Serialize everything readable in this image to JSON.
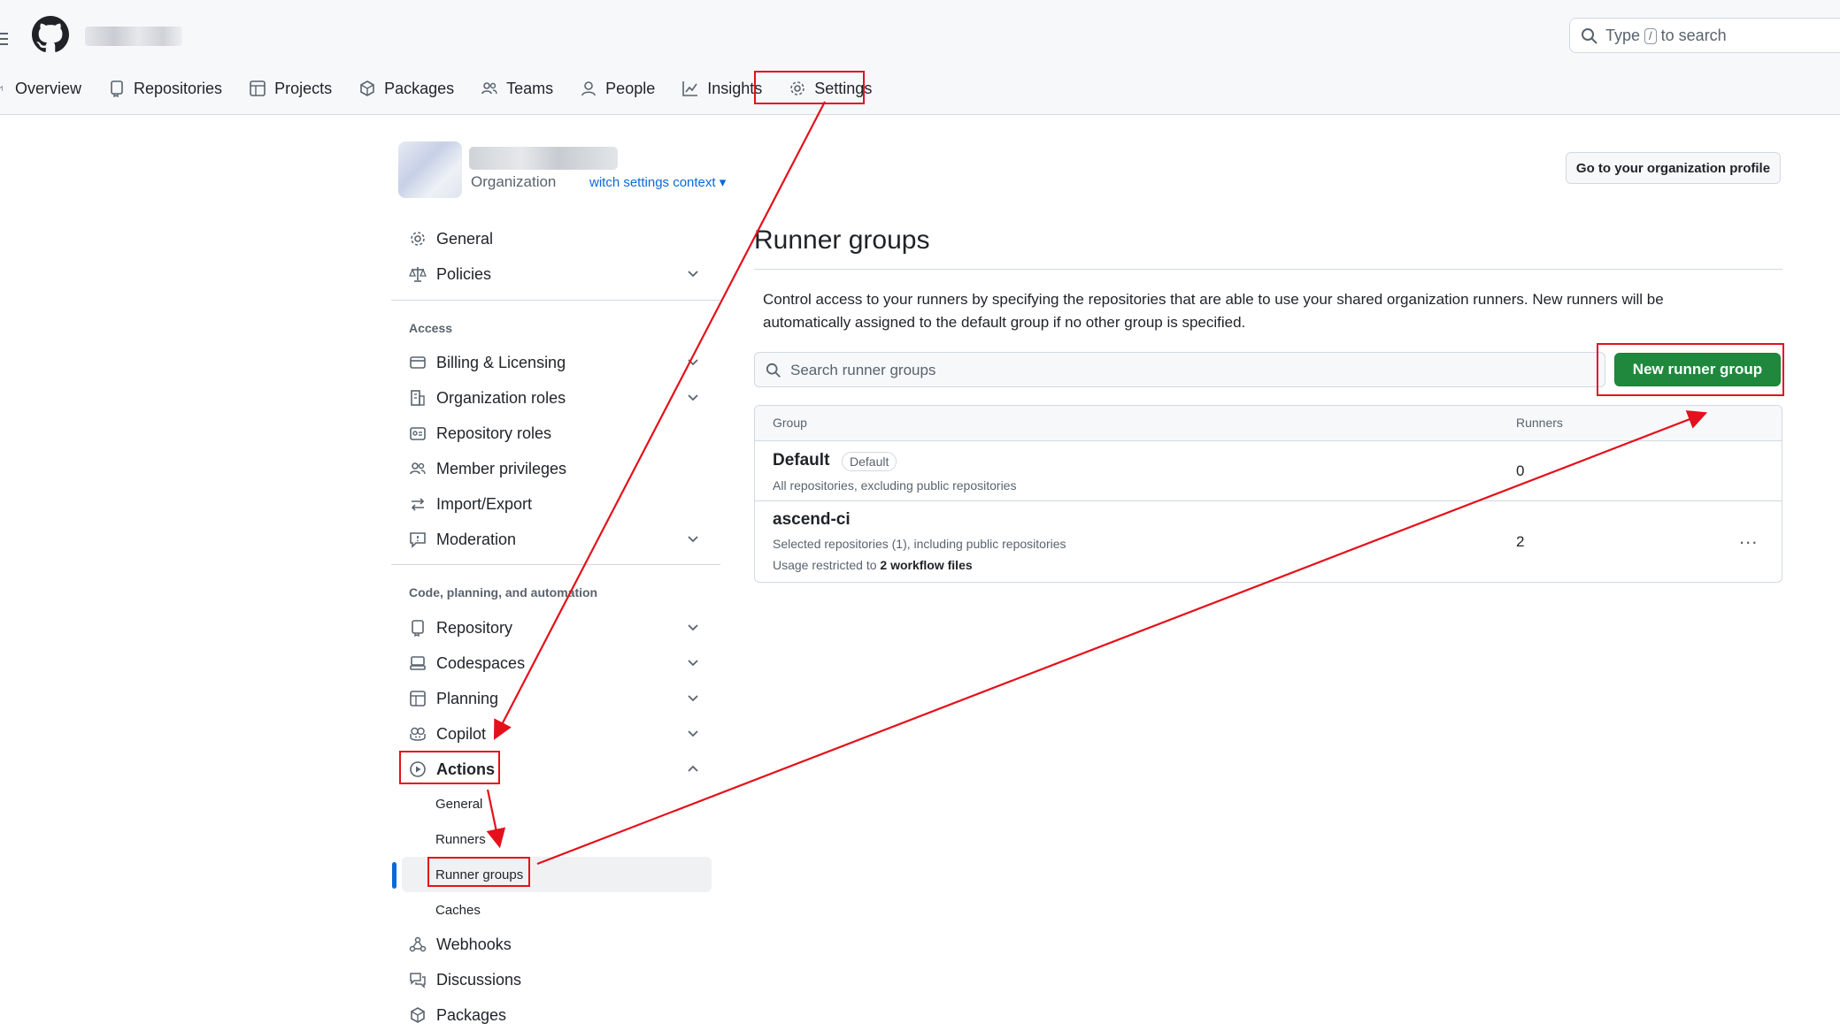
{
  "header": {
    "search_placeholder_before": "Type",
    "search_key": "/",
    "search_placeholder_after": "to search",
    "tabs": [
      {
        "label": "Overview",
        "icon": "home-icon"
      },
      {
        "label": "Repositories",
        "icon": "repo-icon"
      },
      {
        "label": "Projects",
        "icon": "table-icon"
      },
      {
        "label": "Packages",
        "icon": "package-icon"
      },
      {
        "label": "Teams",
        "icon": "people-icon"
      },
      {
        "label": "People",
        "icon": "person-icon"
      },
      {
        "label": "Insights",
        "icon": "graph-icon"
      },
      {
        "label": "Settings",
        "icon": "gear-icon"
      }
    ]
  },
  "org": {
    "kind": "Organization",
    "switch_context": "witch settings context",
    "profile_button": "Go to your organization profile"
  },
  "sidebar": {
    "top_items": [
      "General",
      "Policies"
    ],
    "access_header": "Access",
    "access_items": [
      "Billing & Licensing",
      "Organization roles",
      "Repository roles",
      "Member privileges",
      "Import/Export",
      "Moderation"
    ],
    "code_header": "Code, planning, and automation",
    "code_items": [
      "Repository",
      "Codespaces",
      "Planning",
      "Copilot",
      "Actions"
    ],
    "actions_sub": [
      "General",
      "Runners",
      "Runner groups",
      "Caches"
    ],
    "bottom_items": [
      "Webhooks",
      "Discussions",
      "Packages"
    ]
  },
  "main": {
    "title": "Runner groups",
    "description": "Control access to your runners by specifying the repositories that are able to use your shared organization runners. New runners will be automatically assigned to the default group if no other group is specified.",
    "search_placeholder": "Search runner groups",
    "new_button": "New runner group",
    "table": {
      "col_group": "Group",
      "col_runners": "Runners",
      "rows": [
        {
          "name": "Default",
          "badge": "Default",
          "desc": "All repositories, excluding public repositories",
          "runners": "0"
        },
        {
          "name": "ascend-ci",
          "desc": "Selected repositories (1), including public repositories",
          "usage_prefix": "Usage restricted to",
          "usage_value": "2 workflow files",
          "runners": "2",
          "menu": "..."
        }
      ]
    }
  },
  "colors": {
    "accent_green": "#1f883d",
    "link_blue": "#0969da",
    "annotation_red": "#e3111b"
  }
}
